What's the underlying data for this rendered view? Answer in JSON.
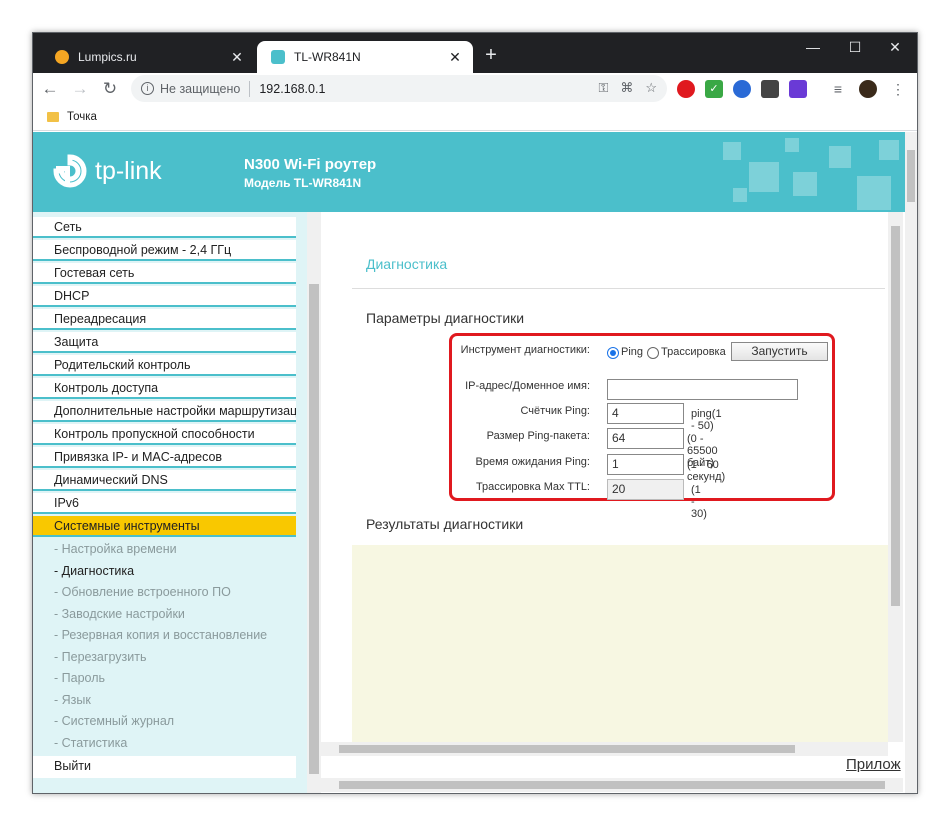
{
  "browser": {
    "tabs": [
      {
        "title": "Lumpics.ru",
        "close": "✕"
      },
      {
        "title": "TL-WR841N",
        "close": "✕"
      }
    ],
    "new_tab": "+",
    "window_controls": {
      "minimize": "—",
      "maximize": "☐",
      "close": "✕"
    },
    "nav": {
      "back": "←",
      "forward": "→",
      "reload": "↻"
    },
    "omnibox": {
      "security": "Не защищено",
      "url": "192.168.0.1"
    },
    "bookmarks": [
      {
        "label": "Точка"
      }
    ]
  },
  "router": {
    "brand": "tp-link",
    "product": "N300 Wi-Fi роутер",
    "model": "Модель TL-WR841N",
    "menu": [
      "Сеть",
      "Беспроводной режим - 2,4 ГГц",
      "Гостевая сеть",
      "DHCP",
      "Переадресация",
      "Защита",
      "Родительский контроль",
      "Контроль доступа",
      "Дополнительные настройки маршрутизации",
      "Контроль пропускной способности",
      "Привязка IP- и MAC-адресов",
      "Динамический DNS",
      "IPv6",
      "Системные инструменты"
    ],
    "submenu": [
      "- Настройка времени",
      "- Диагностика",
      "- Обновление встроенного ПО",
      "- Заводские настройки",
      "- Резервная копия и восстановление",
      "- Перезагрузить",
      "- Пароль",
      "- Язык",
      "- Системный журнал",
      "- Статистика"
    ],
    "logout": "Выйти",
    "page_title": "Диагностика",
    "params_title": "Параметры диагностики",
    "form": {
      "tool_label": "Инструмент диагностики:",
      "option_ping": "Ping",
      "option_trace": "Трассировка",
      "selected_tool": "Ping",
      "run_button": "Запустить",
      "ip_label": "IP-адрес/Доменное имя:",
      "ip_value": "",
      "count_label": "Счётчик Ping:",
      "count_value": "4",
      "count_hint": "ping(1 - 50)",
      "size_label": "Размер Ping-пакета:",
      "size_value": "64",
      "size_hint": "(0 - 65500 байт)",
      "timeout_label": "Время ожидания Ping:",
      "timeout_value": "1",
      "timeout_hint": "(1 - 60 секунд)",
      "ttl_label": "Трассировка Max TTL:",
      "ttl_value": "20",
      "ttl_hint": "(1 - 30)"
    },
    "results_title": "Результаты диагностики",
    "help_link": "Прилож"
  }
}
